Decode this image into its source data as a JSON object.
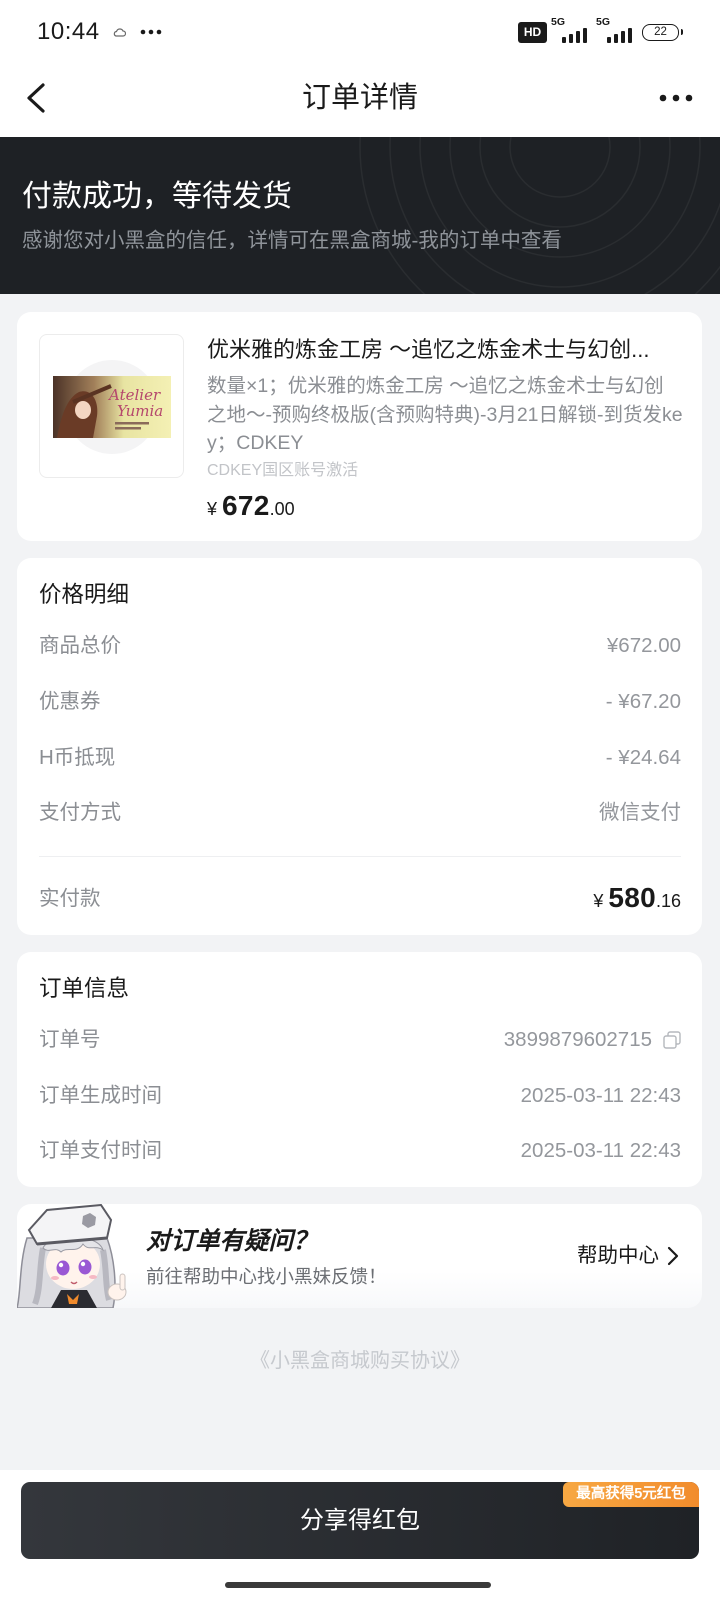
{
  "colors": {
    "page_bg": "#f2f3f5",
    "banner_bg": "#1e2125",
    "button_bg": "#1f2226",
    "badge_bg": "#f28c2c",
    "text_primary": "#1a1a1a"
  },
  "icons": {
    "cloud": "cloud-icon",
    "notification_more": "more-dots-icon",
    "hd": "hd-voice-icon",
    "signal": "cellular-signal-icon",
    "battery": "battery-icon",
    "back": "chevron-left-icon",
    "more": "more-horizontal-icon",
    "copy": "copy-icon",
    "help_arrow": "chevron-right-icon"
  },
  "status_bar": {
    "time": "10:44",
    "hd_label": "HD",
    "network_1": "5G",
    "network_2": "5G",
    "battery": "22"
  },
  "header": {
    "title": "订单详情"
  },
  "banner": {
    "title": "付款成功，等待发货",
    "subtitle": "感谢您对小黑盒的信任，详情可在黑盒商城-我的订单中查看"
  },
  "product": {
    "cover_logo": [
      "Atelier",
      "Yumia"
    ],
    "title": "优米雅的炼金工房 ～追忆之炼金术士与幻创...",
    "description": "数量×1；优米雅的炼金工房 ～追忆之炼金术士与幻创之地～-预购终极版(含预购特典)-3月21日解锁-到货发key；CDKEY",
    "note": "CDKEY国区账号激活",
    "price": {
      "currency": "¥",
      "integer": "672",
      "decimal": ".00"
    }
  },
  "price_detail": {
    "heading": "价格明细",
    "rows": [
      {
        "label": "商品总价",
        "value": "¥672.00"
      },
      {
        "label": "优惠券",
        "value": "- ¥67.20"
      },
      {
        "label": "H币抵现",
        "value": "- ¥24.64"
      },
      {
        "label": "支付方式",
        "value": "微信支付"
      }
    ],
    "total": {
      "label": "实付款",
      "currency": "¥",
      "integer": "580",
      "decimal": ".16"
    }
  },
  "order_info": {
    "heading": "订单信息",
    "rows": [
      {
        "label": "订单号",
        "value": "3899879602715"
      },
      {
        "label": "订单生成时间",
        "value": "2025-03-11 22:43"
      },
      {
        "label": "订单支付时间",
        "value": "2025-03-11 22:43"
      }
    ]
  },
  "help": {
    "title": "对订单有疑问？",
    "subtitle": "前往帮助中心找小黑妹反馈！",
    "link": "帮助中心"
  },
  "agreement": "《小黑盒商城购买协议》",
  "share": {
    "label": "分享得红包",
    "badge": "最高获得5元红包"
  }
}
